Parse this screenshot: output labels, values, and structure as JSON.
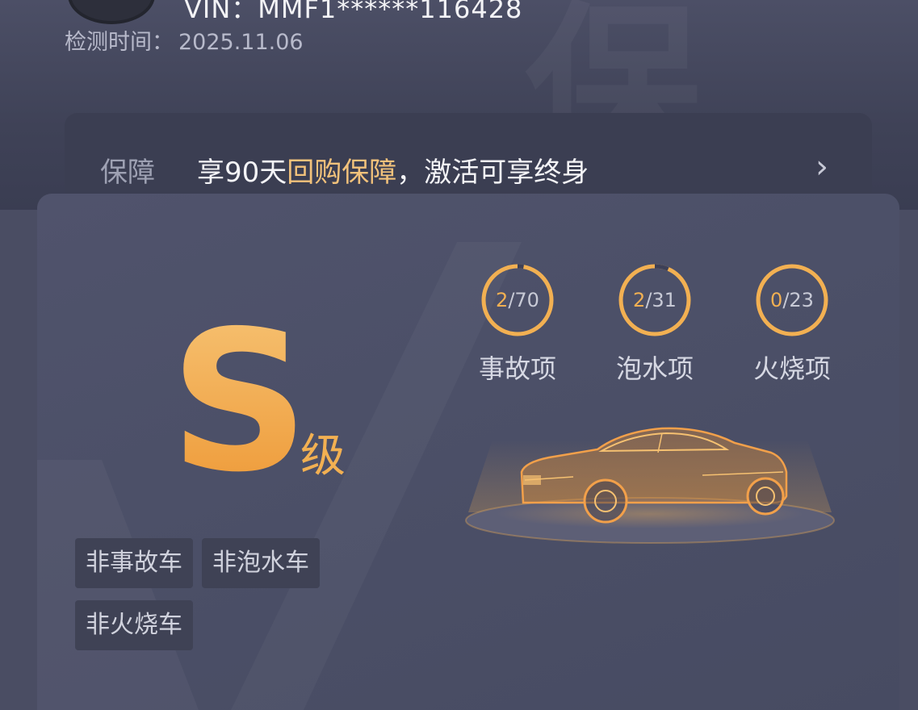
{
  "header": {
    "vin": "VIN：MMF1******116428",
    "check_time_label": "检测时间：",
    "check_time_value": "2025.11.06"
  },
  "guarantee": {
    "label": "保障",
    "text_prefix": "享90天",
    "text_highlight": "回购保障",
    "text_suffix": "，激活可享终身",
    "chevron": "›"
  },
  "grade": {
    "letter": "S",
    "suffix": "级"
  },
  "inspections": [
    {
      "found": "2",
      "total": "/70",
      "label": "事故项",
      "fraction": 0.0286
    },
    {
      "found": "2",
      "total": "/31",
      "label": "泡水项",
      "fraction": 0.0645
    },
    {
      "found": "0",
      "total": "/23",
      "label": "火烧项",
      "fraction": 0.0
    }
  ],
  "tags": [
    "非事故车",
    "非泡水车",
    "非火烧车"
  ],
  "colors": {
    "accent": "#f2b052",
    "ring_progress": "#3d4057"
  }
}
